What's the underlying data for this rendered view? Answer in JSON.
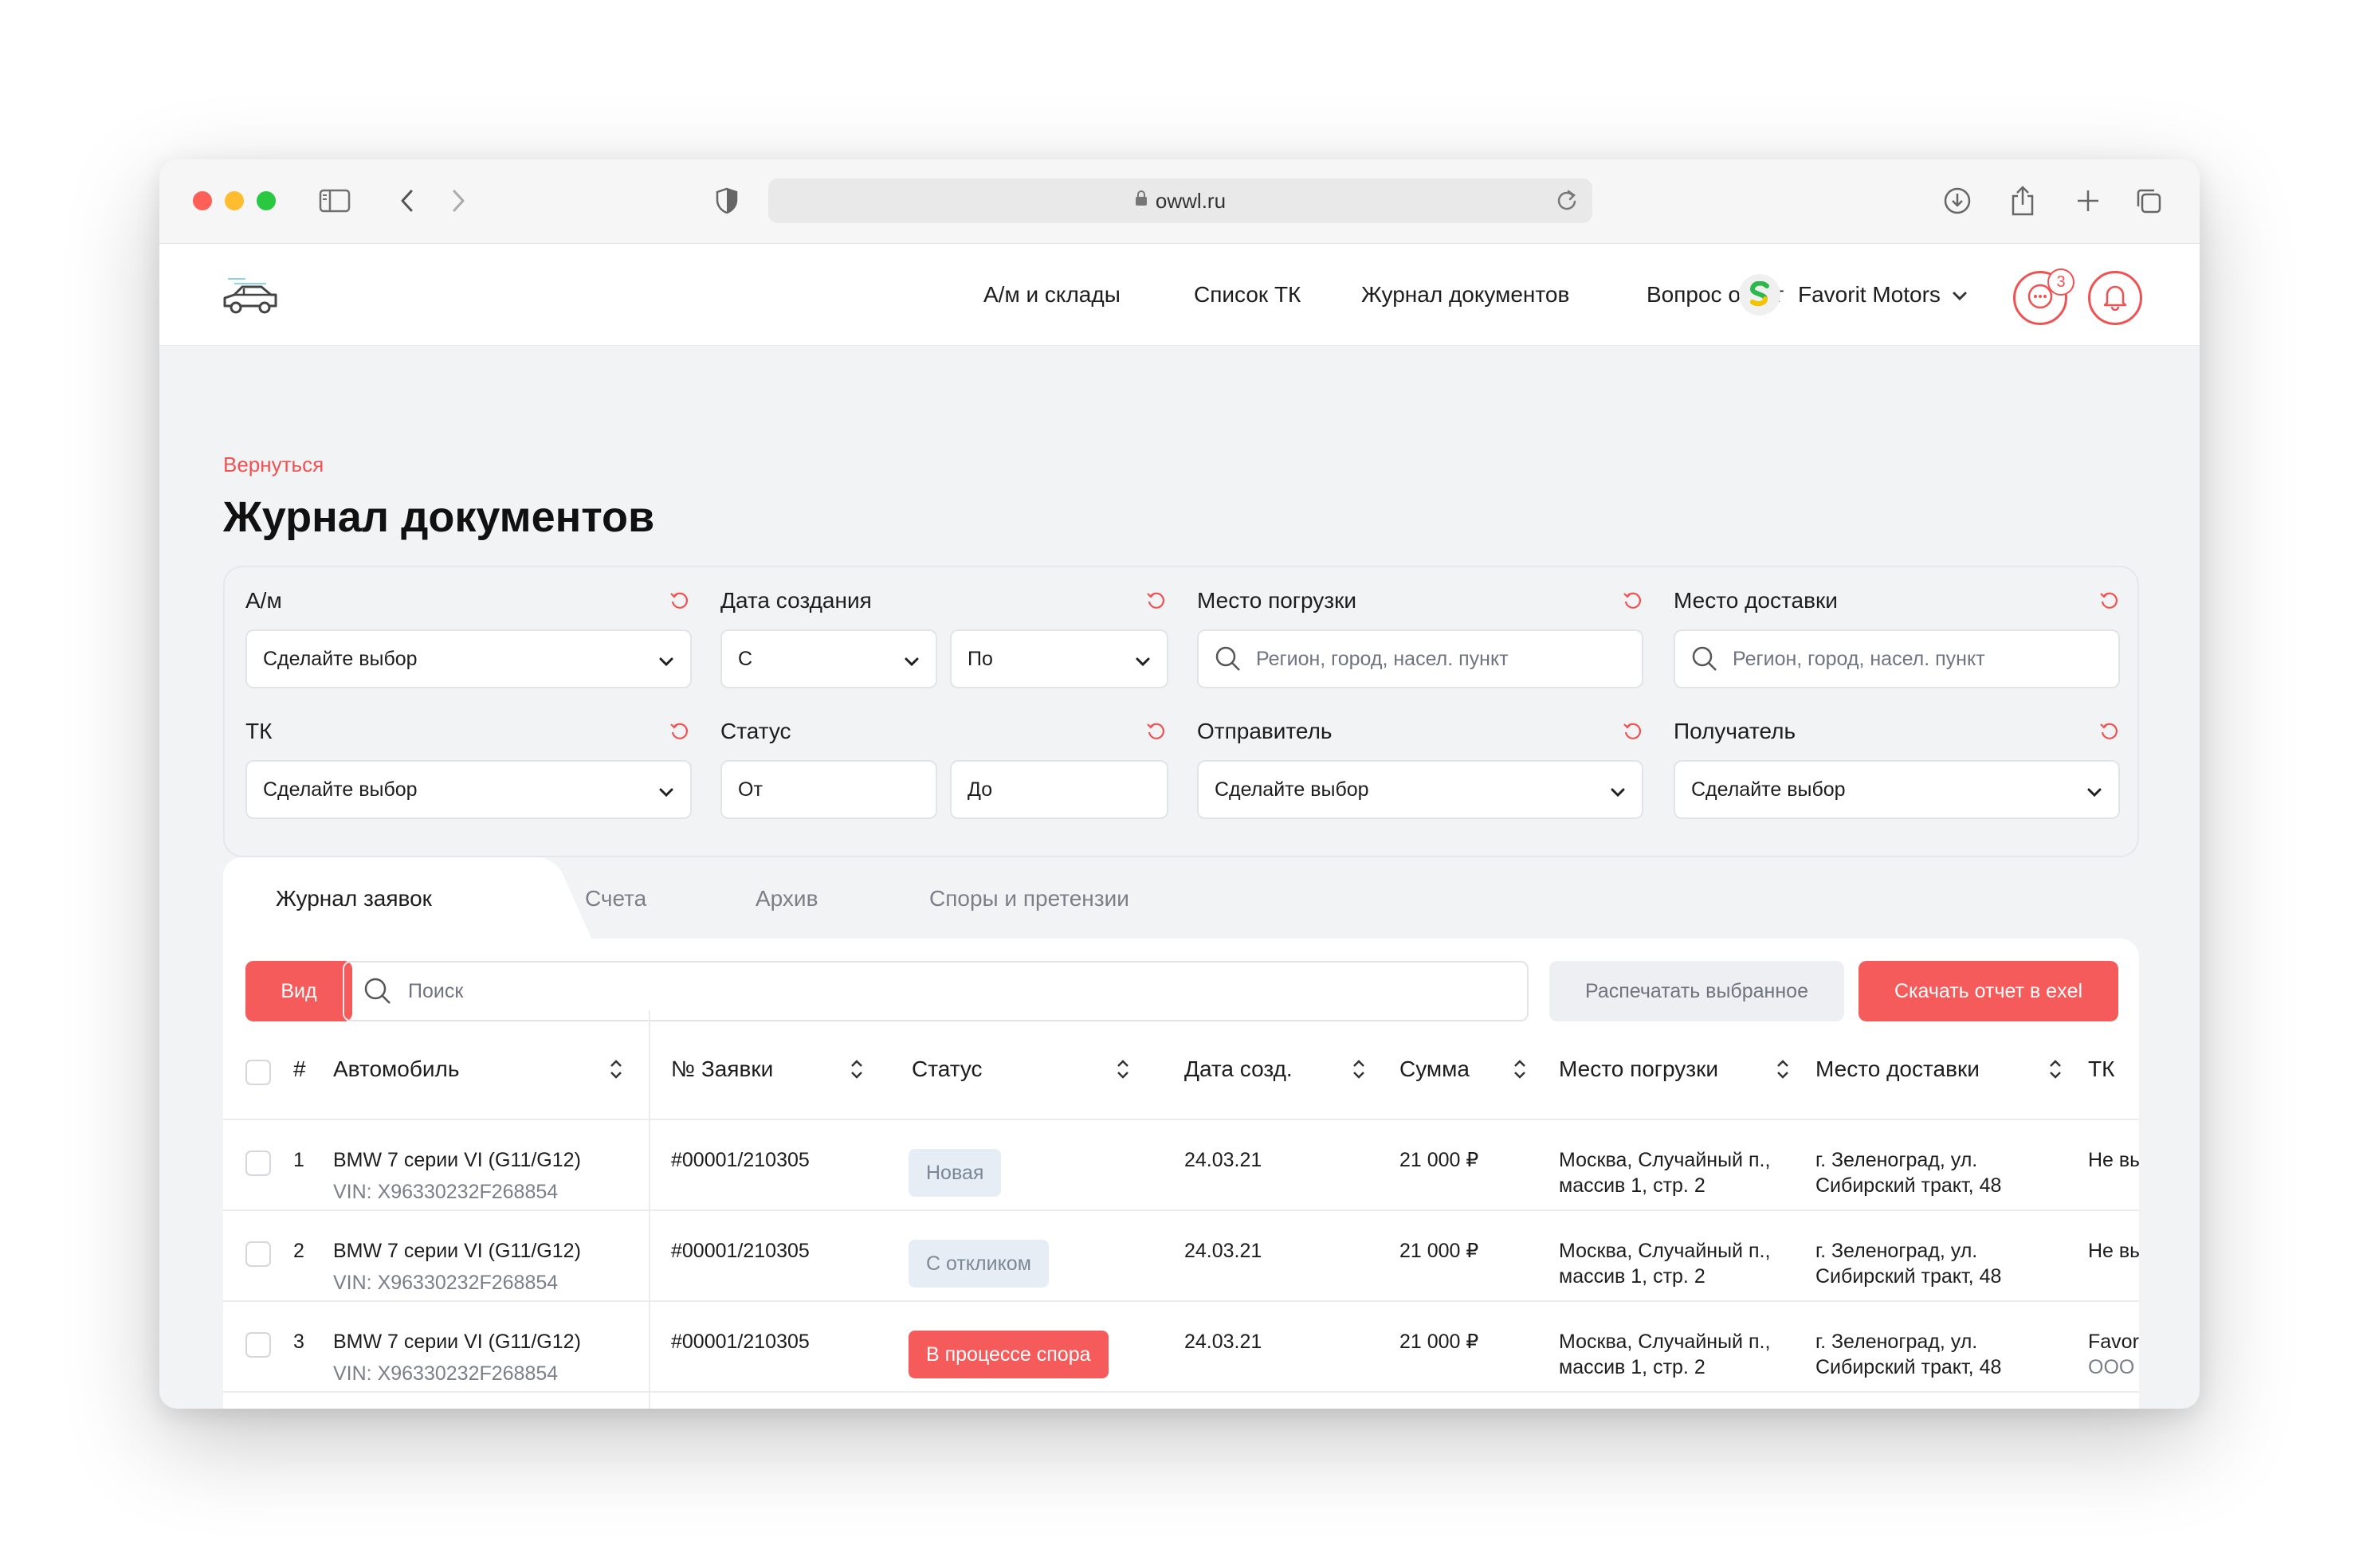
{
  "browser": {
    "url": "owwl.ru"
  },
  "nav": {
    "items": [
      "А/м и склады",
      "Список ТК",
      "Журнал документов",
      "Вопрос ответ"
    ],
    "company": "Favorit Motors",
    "messages_count": "3"
  },
  "page": {
    "back": "Вернуться",
    "title": "Журнал документов"
  },
  "filters": {
    "am": {
      "label": "А/м",
      "value": "Сделайте выбор"
    },
    "created": {
      "label": "Дата создания",
      "from": "С",
      "to": "По"
    },
    "loading": {
      "label": "Место погрузки",
      "placeholder": "Регион, город, насел. пункт"
    },
    "delivery": {
      "label": "Место доставки",
      "placeholder": "Регион, город, насел. пункт"
    },
    "tk": {
      "label": "ТК",
      "value": "Сделайте выбор"
    },
    "status": {
      "label": "Статус",
      "from": "От",
      "to": "До"
    },
    "sender": {
      "label": "Отправитель",
      "value": "Сделайте выбор"
    },
    "recipient": {
      "label": "Получатель",
      "value": "Сделайте выбор"
    }
  },
  "tabs": [
    "Журнал заявок",
    "Счета",
    "Архив",
    "Споры и претензии"
  ],
  "toolbar": {
    "view": "Вид",
    "search_placeholder": "Поиск",
    "print": "Распечатать выбранное",
    "download": "Скачать отчет в exel"
  },
  "table": {
    "columns": [
      "#",
      "Автомобиль",
      "№ Заявки",
      "Статус",
      "Дата созд.",
      "Сумма",
      "Место погрузки",
      "Место доставки",
      "ТК"
    ],
    "rows": [
      {
        "n": "1",
        "car": "BMW 7 серии VI (G11/G12)",
        "vin": "VIN: X96330232F268854",
        "order": "#00001/210305",
        "status": "Новая",
        "date": "24.03.21",
        "sum": "21 000 ₽",
        "load1": "Москва, Случайный п.,",
        "load2": "массив 1, стр. 2",
        "del1": "г. Зеленоград, ул.",
        "del2": "Сибирский тракт, 48",
        "tk1": "Не вы",
        "tk2": ""
      },
      {
        "n": "2",
        "car": "BMW 7 серии VI (G11/G12)",
        "vin": "VIN: X96330232F268854",
        "order": "#00001/210305",
        "status": "С откликом",
        "date": "24.03.21",
        "sum": "21 000 ₽",
        "load1": "Москва, Случайный п.,",
        "load2": "массив 1, стр. 2",
        "del1": "г. Зеленоград, ул.",
        "del2": "Сибирский тракт, 48",
        "tk1": "Не вы",
        "tk2": ""
      },
      {
        "n": "3",
        "car": "BMW 7 серии VI (G11/G12)",
        "vin": "VIN: X96330232F268854",
        "order": "#00001/210305",
        "status": "В процессе спора",
        "date": "24.03.21",
        "sum": "21 000 ₽",
        "load1": "Москва, Случайный п.,",
        "load2": "массив 1, стр. 2",
        "del1": "г. Зеленоград, ул.",
        "del2": "Сибирский тракт, 48",
        "tk1": "Favori",
        "tk2": "ООО '"
      }
    ]
  },
  "colors": {
    "accent": "#f55b5b",
    "background": "#f2f3f5",
    "status_light": "#e6edf4"
  }
}
